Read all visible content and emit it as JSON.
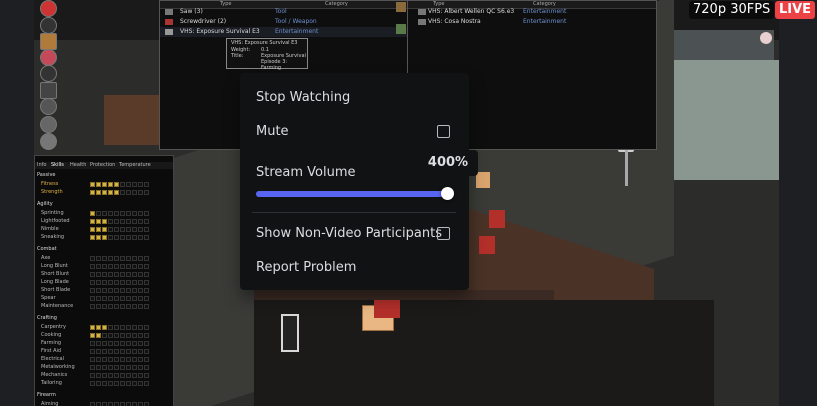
{
  "overlay": {
    "resolution_badge": "720p 30FPS",
    "live_badge": "LIVE"
  },
  "inventory_left": {
    "headers": [
      "Type",
      "Category"
    ],
    "rows": [
      {
        "name": "Saw (3)",
        "category": "Tool"
      },
      {
        "name": "Screwdriver (2)",
        "category": "Tool / Weapon"
      },
      {
        "name": "VHS: Exposure Survival E3",
        "category": "Entertainment"
      }
    ]
  },
  "inventory_right": {
    "headers": [
      "Type",
      "Category"
    ],
    "rows": [
      {
        "name": "VHS: Albert Wellen QC S6.e3",
        "category": "Entertainment"
      },
      {
        "name": "VHS: Cosa Nostra",
        "category": "Entertainment"
      }
    ]
  },
  "tooltip": {
    "title": "VHS: Exposure Survival E3",
    "weight_label": "Weight:",
    "weight_value": "0.1",
    "title_label": "Title:",
    "title_value": "Exposure Survival",
    "episode": "Episode 3: Farming"
  },
  "skills_panel": {
    "tabs": [
      "Info",
      "Skills",
      "Health",
      "Protection",
      "Temperature"
    ],
    "sections": [
      {
        "name": "Passive",
        "skills": [
          {
            "label": "Fitness",
            "level": 5
          },
          {
            "label": "Strength",
            "level": 5
          }
        ]
      },
      {
        "name": "Agility",
        "skills": [
          {
            "label": "Sprinting",
            "level": 1
          },
          {
            "label": "Lightfooted",
            "level": 3
          },
          {
            "label": "Nimble",
            "level": 3
          },
          {
            "label": "Sneaking",
            "level": 3
          }
        ]
      },
      {
        "name": "Combat",
        "skills": [
          {
            "label": "Axe",
            "level": 0
          },
          {
            "label": "Long Blunt",
            "level": 0
          },
          {
            "label": "Short Blunt",
            "level": 0
          },
          {
            "label": "Long Blade",
            "level": 0
          },
          {
            "label": "Short Blade",
            "level": 0
          },
          {
            "label": "Spear",
            "level": 0
          },
          {
            "label": "Maintenance",
            "level": 0
          }
        ]
      },
      {
        "name": "Crafting",
        "skills": [
          {
            "label": "Carpentry",
            "level": 3
          },
          {
            "label": "Cooking",
            "level": 2
          },
          {
            "label": "Farming",
            "level": 0
          },
          {
            "label": "First Aid",
            "level": 0
          },
          {
            "label": "Electrical",
            "level": 0
          },
          {
            "label": "Metalworking",
            "level": 0
          },
          {
            "label": "Mechanics",
            "level": 0
          },
          {
            "label": "Tailoring",
            "level": 0
          }
        ]
      },
      {
        "name": "Firearm",
        "skills": [
          {
            "label": "Aiming",
            "level": 0
          }
        ]
      }
    ]
  },
  "context_menu": {
    "stop_watching": "Stop Watching",
    "mute": "Mute",
    "mute_checked": false,
    "stream_volume_label": "Stream Volume",
    "volume_value": "400%",
    "volume_fraction": 1.0,
    "show_non_video": "Show Non-Video Participants",
    "show_non_video_checked": false,
    "report_problem": "Report Problem"
  },
  "colors": {
    "accent": "#5865f2",
    "live": "#ed4245",
    "menu_bg": "#111214"
  }
}
